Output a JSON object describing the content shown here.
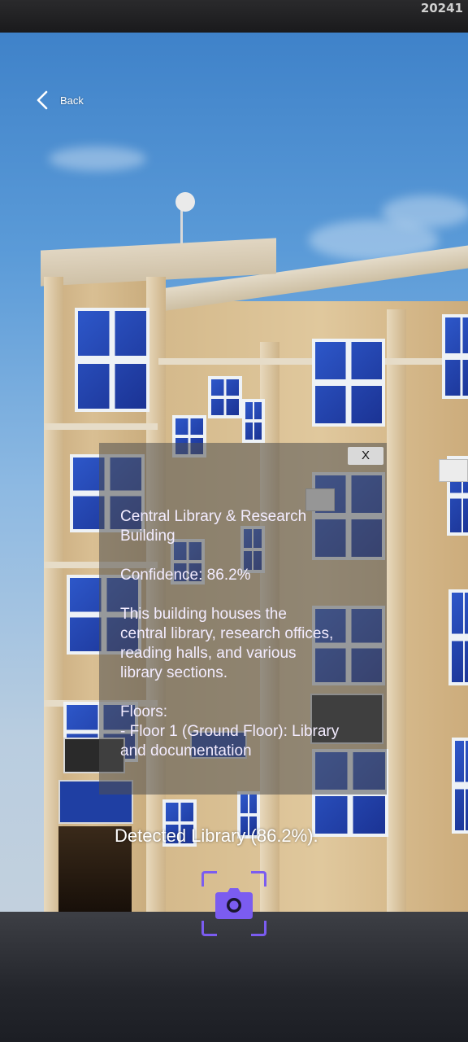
{
  "status": {
    "stamp": "20241"
  },
  "nav": {
    "back_label": "Back",
    "back_icon": "chevron-left-icon"
  },
  "info": {
    "close_label": "X",
    "title_line1": "Central Library & Research",
    "title_line2": "Building",
    "confidence": "Confidence: 86.2%",
    "desc_lines": [
      "This building houses the",
      "central library, research offices,",
      "reading halls, and various",
      "library sections."
    ],
    "floors_heading": "Floors:",
    "floor_lines": [
      "- Floor 1 (Ground Floor): Library",
      "and documentation"
    ]
  },
  "detection": {
    "text": "Detected Library (86.2%)."
  },
  "capture": {
    "icon": "camera-icon",
    "accent": "#7b5cf0"
  }
}
